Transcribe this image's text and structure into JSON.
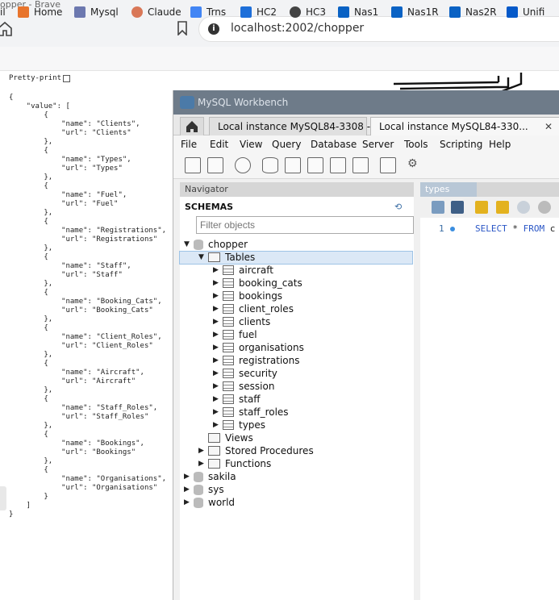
{
  "browser": {
    "title": "opper - Brave",
    "url": "localhost:2002/chopper",
    "bookmarks": [
      {
        "label": "Home",
        "icon": "home-app-icon",
        "color": "#e8742c"
      },
      {
        "label": "Mysql",
        "icon": "phpmyadmin-icon",
        "color": "#6c78af"
      },
      {
        "label": "Claude",
        "icon": "claude-icon",
        "color": "#d97757"
      },
      {
        "label": "Trns",
        "icon": "translate-icon",
        "color": "#4285f4"
      },
      {
        "label": "HC2",
        "icon": "house-icon",
        "color": "#1e6fd9"
      },
      {
        "label": "HC3",
        "icon": "globe-icon",
        "color": "#444444"
      },
      {
        "label": "Nas1",
        "icon": "dsm-icon",
        "color": "#0a62c4"
      },
      {
        "label": "Nas1R",
        "icon": "dsm-icon",
        "color": "#0a62c4"
      },
      {
        "label": "Nas2R",
        "icon": "dsm-icon",
        "color": "#0a62c4"
      },
      {
        "label": "Unifi",
        "icon": "unifi-icon",
        "color": "#0559c9"
      }
    ],
    "bookmark_first_partial": "il"
  },
  "json_view": {
    "pretty_print_label": "Pretty-print",
    "lines": [
      "{",
      "    \"value\": [",
      "        {",
      "            \"name\": \"Clients\",",
      "            \"url\": \"Clients\"",
      "        },",
      "        {",
      "            \"name\": \"Types\",",
      "            \"url\": \"Types\"",
      "        },",
      "        {",
      "            \"name\": \"Fuel\",",
      "            \"url\": \"Fuel\"",
      "        },",
      "        {",
      "            \"name\": \"Registrations\",",
      "            \"url\": \"Registrations\"",
      "        },",
      "        {",
      "            \"name\": \"Staff\",",
      "            \"url\": \"Staff\"",
      "        },",
      "        {",
      "            \"name\": \"Booking_Cats\",",
      "            \"url\": \"Booking_Cats\"",
      "        },",
      "        {",
      "            \"name\": \"Client_Roles\",",
      "            \"url\": \"Client_Roles\"",
      "        },",
      "        {",
      "            \"name\": \"Aircraft\",",
      "            \"url\": \"Aircraft\"",
      "        },",
      "        {",
      "            \"name\": \"Staff_Roles\",",
      "            \"url\": \"Staff_Roles\"",
      "        },",
      "        {",
      "            \"name\": \"Bookings\",",
      "            \"url\": \"Bookings\"",
      "        },",
      "        {",
      "            \"name\": \"Organisations\",",
      "            \"url\": \"Organisations\"",
      "        }",
      "    ]",
      "}"
    ]
  },
  "workbench": {
    "title": "MySQL Workbench",
    "tabs": [
      {
        "label": "Local instance MySQL84-3308 - ...",
        "close": "✕"
      },
      {
        "label": "Local instance MySQL84-330...",
        "close": "✕"
      }
    ],
    "menu": [
      "File",
      "Edit",
      "View",
      "Query",
      "Database",
      "Server",
      "Tools",
      "Scripting",
      "Help"
    ],
    "navigator_label": "Navigator",
    "schemas_title": "SCHEMAS",
    "filter_placeholder": "Filter objects",
    "schema_open": "chopper",
    "tables_label": "Tables",
    "tables": [
      "aircraft",
      "booking_cats",
      "bookings",
      "client_roles",
      "clients",
      "fuel",
      "organisations",
      "registrations",
      "security",
      "session",
      "staff",
      "staff_roles",
      "types"
    ],
    "other_nodes": [
      "Views",
      "Stored Procedures",
      "Functions"
    ],
    "other_schemas": [
      "sakila",
      "sys",
      "world"
    ],
    "editor_tab": "types",
    "line_number": "1",
    "sql_kw1": "SELECT",
    "sql_mid": " * ",
    "sql_kw2": "FROM",
    "sql_tail": " c"
  }
}
